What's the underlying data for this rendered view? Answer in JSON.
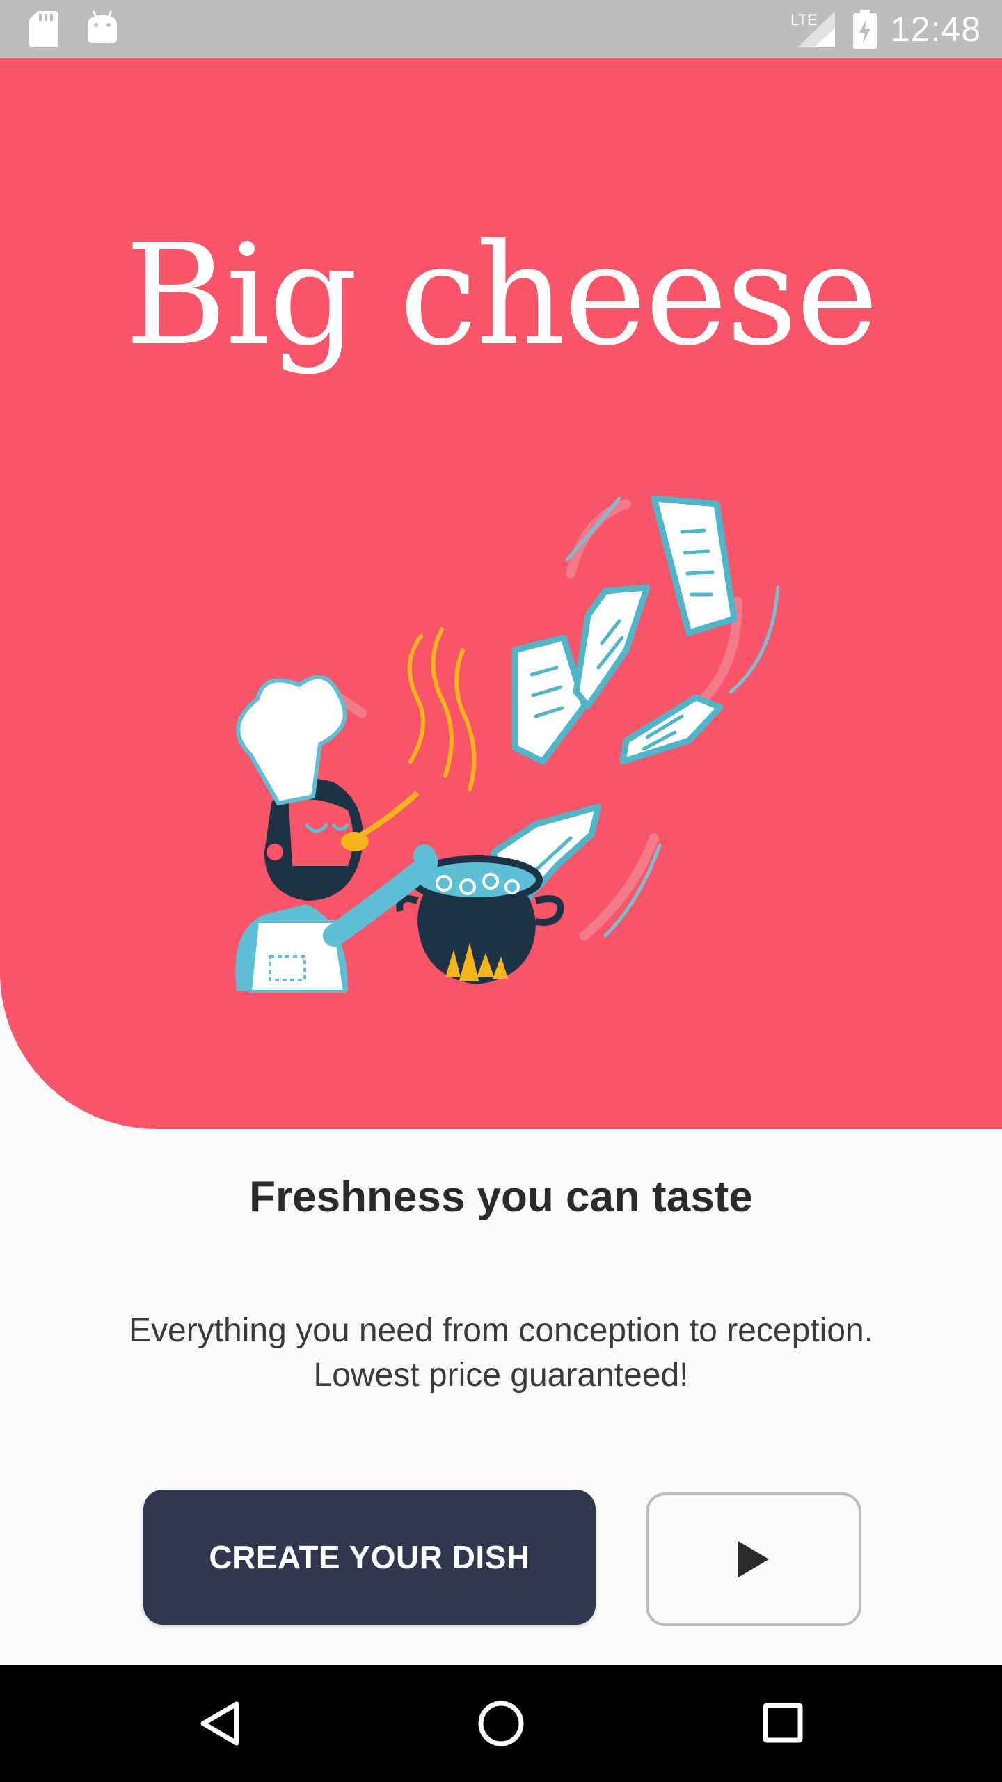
{
  "status_bar": {
    "time": "12:48",
    "network": "LTE",
    "icons": [
      "sd-card-icon",
      "android-icon",
      "signal-icon",
      "battery-charging-icon"
    ]
  },
  "hero": {
    "title": "Big cheese",
    "background_color": "#f95467",
    "illustration": "chef-tasting-soup-with-flying-recipes"
  },
  "content": {
    "tagline": "Freshness you can taste",
    "description_line1": "Everything you need from conception to reception.",
    "description_line2": "Lowest price guaranteed!"
  },
  "actions": {
    "create_label": "CREATE YOUR DISH",
    "create_color": "#323750",
    "play_icon": "play-icon"
  },
  "nav_bar": {
    "buttons": [
      "back-icon",
      "home-icon",
      "recents-icon"
    ]
  }
}
